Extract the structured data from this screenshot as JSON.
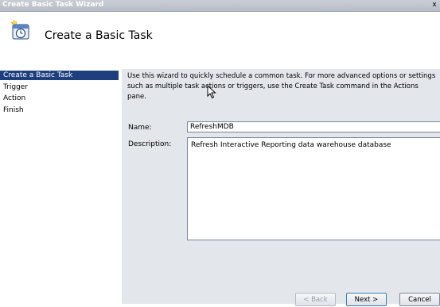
{
  "window": {
    "title": "Create Basic Task Wizard",
    "close_glyph": "x"
  },
  "header": {
    "heading": "Create a Basic Task",
    "icon": "task-scheduler-clock-icon"
  },
  "sidebar": {
    "steps": [
      {
        "label": "Create a Basic Task",
        "active": true
      },
      {
        "label": "Trigger",
        "active": false
      },
      {
        "label": "Action",
        "active": false
      },
      {
        "label": "Finish",
        "active": false
      }
    ]
  },
  "main": {
    "intro_line1": "Use this wizard to quickly schedule a common task.  For more advanced options or settings",
    "intro_line2": "such as multiple task actions or triggers, use the Create Task command in the Actions pane.",
    "name_label": "Name:",
    "name_value": "RefreshMDB",
    "description_label": "Description:",
    "description_value": "Refresh Interactive Reporting data warehouse database"
  },
  "buttons": {
    "back": "< Back",
    "next": "Next >",
    "cancel": "Cancel"
  },
  "colors": {
    "active_step": "#1e3f7e",
    "content_bg": "#e3e6ea",
    "titlebar": "#b6bcc6"
  }
}
